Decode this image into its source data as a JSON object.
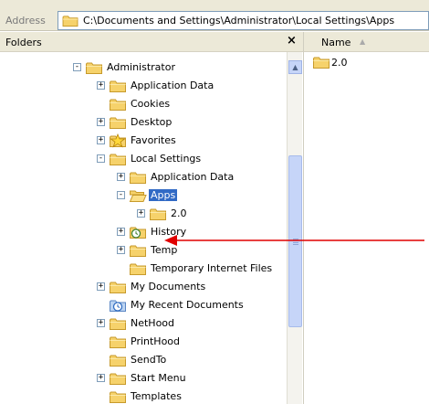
{
  "address_bar": {
    "label": "Address",
    "path": "C:\\Documents and Settings\\Administrator\\Local Settings\\Apps",
    "icon": "folder-icon"
  },
  "folders_pane": {
    "title": "Folders",
    "close_label": "×",
    "tree": [
      {
        "label": "Administrator",
        "expander": "-",
        "icon": "folder"
      },
      {
        "label": "Application Data",
        "expander": "+",
        "icon": "folder"
      },
      {
        "label": "Cookies",
        "expander": "",
        "icon": "folder"
      },
      {
        "label": "Desktop",
        "expander": "+",
        "icon": "folder"
      },
      {
        "label": "Favorites",
        "expander": "+",
        "icon": "star-folder"
      },
      {
        "label": "Local Settings",
        "expander": "-",
        "icon": "folder"
      },
      {
        "label": "Application Data",
        "expander": "+",
        "icon": "folder"
      },
      {
        "label": "Apps",
        "expander": "-",
        "icon": "open-folder",
        "selected": true
      },
      {
        "label": "2.0",
        "expander": "+",
        "icon": "folder"
      },
      {
        "label": "History",
        "expander": "+",
        "icon": "history-folder"
      },
      {
        "label": "Temp",
        "expander": "+",
        "icon": "folder"
      },
      {
        "label": "Temporary Internet Files",
        "expander": "",
        "icon": "folder"
      },
      {
        "label": "My Documents",
        "expander": "+",
        "icon": "folder"
      },
      {
        "label": "My Recent Documents",
        "expander": "",
        "icon": "recent-folder"
      },
      {
        "label": "NetHood",
        "expander": "+",
        "icon": "folder"
      },
      {
        "label": "PrintHood",
        "expander": "",
        "icon": "folder"
      },
      {
        "label": "SendTo",
        "expander": "",
        "icon": "folder"
      },
      {
        "label": "Start Menu",
        "expander": "+",
        "icon": "folder"
      },
      {
        "label": "Templates",
        "expander": "",
        "icon": "folder"
      }
    ]
  },
  "contents_pane": {
    "column_name": "Name",
    "sort_indicator": "▲",
    "items": [
      {
        "label": "2.0",
        "icon": "folder"
      }
    ]
  },
  "annotation": {
    "color": "#e00000"
  },
  "colors": {
    "selection": "#316ac5",
    "folder": "#f6d26b",
    "folder_edge": "#c79a2b"
  }
}
